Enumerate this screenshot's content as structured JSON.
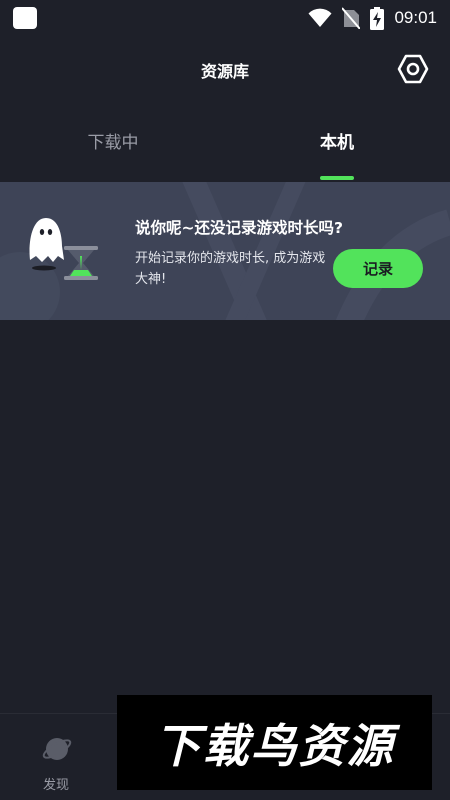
{
  "status_bar": {
    "time": "09:01",
    "icons": [
      "app-notification-icon",
      "wifi-icon",
      "no-sim-icon",
      "battery-charging-icon"
    ]
  },
  "header": {
    "title": "资源库",
    "settings_icon": "gear-icon"
  },
  "tabs": [
    {
      "label": "下载中",
      "active": false
    },
    {
      "label": "本机",
      "active": true
    }
  ],
  "banner": {
    "illustration": "ghost-hourglass",
    "title": "说你呢~还没记录游戏时长吗?",
    "description": "开始记录你的游戏时长, 成为游戏大神!",
    "button_label": "记录"
  },
  "bottom_nav": {
    "items": [
      {
        "label": "发现",
        "icon": "planet-icon"
      }
    ]
  },
  "watermark": {
    "text": "下载鸟资源"
  },
  "colors": {
    "background": "#1e2029",
    "banner_bg": "#3e4457",
    "accent": "#52e35b",
    "inactive_text": "#9a9ca6"
  }
}
